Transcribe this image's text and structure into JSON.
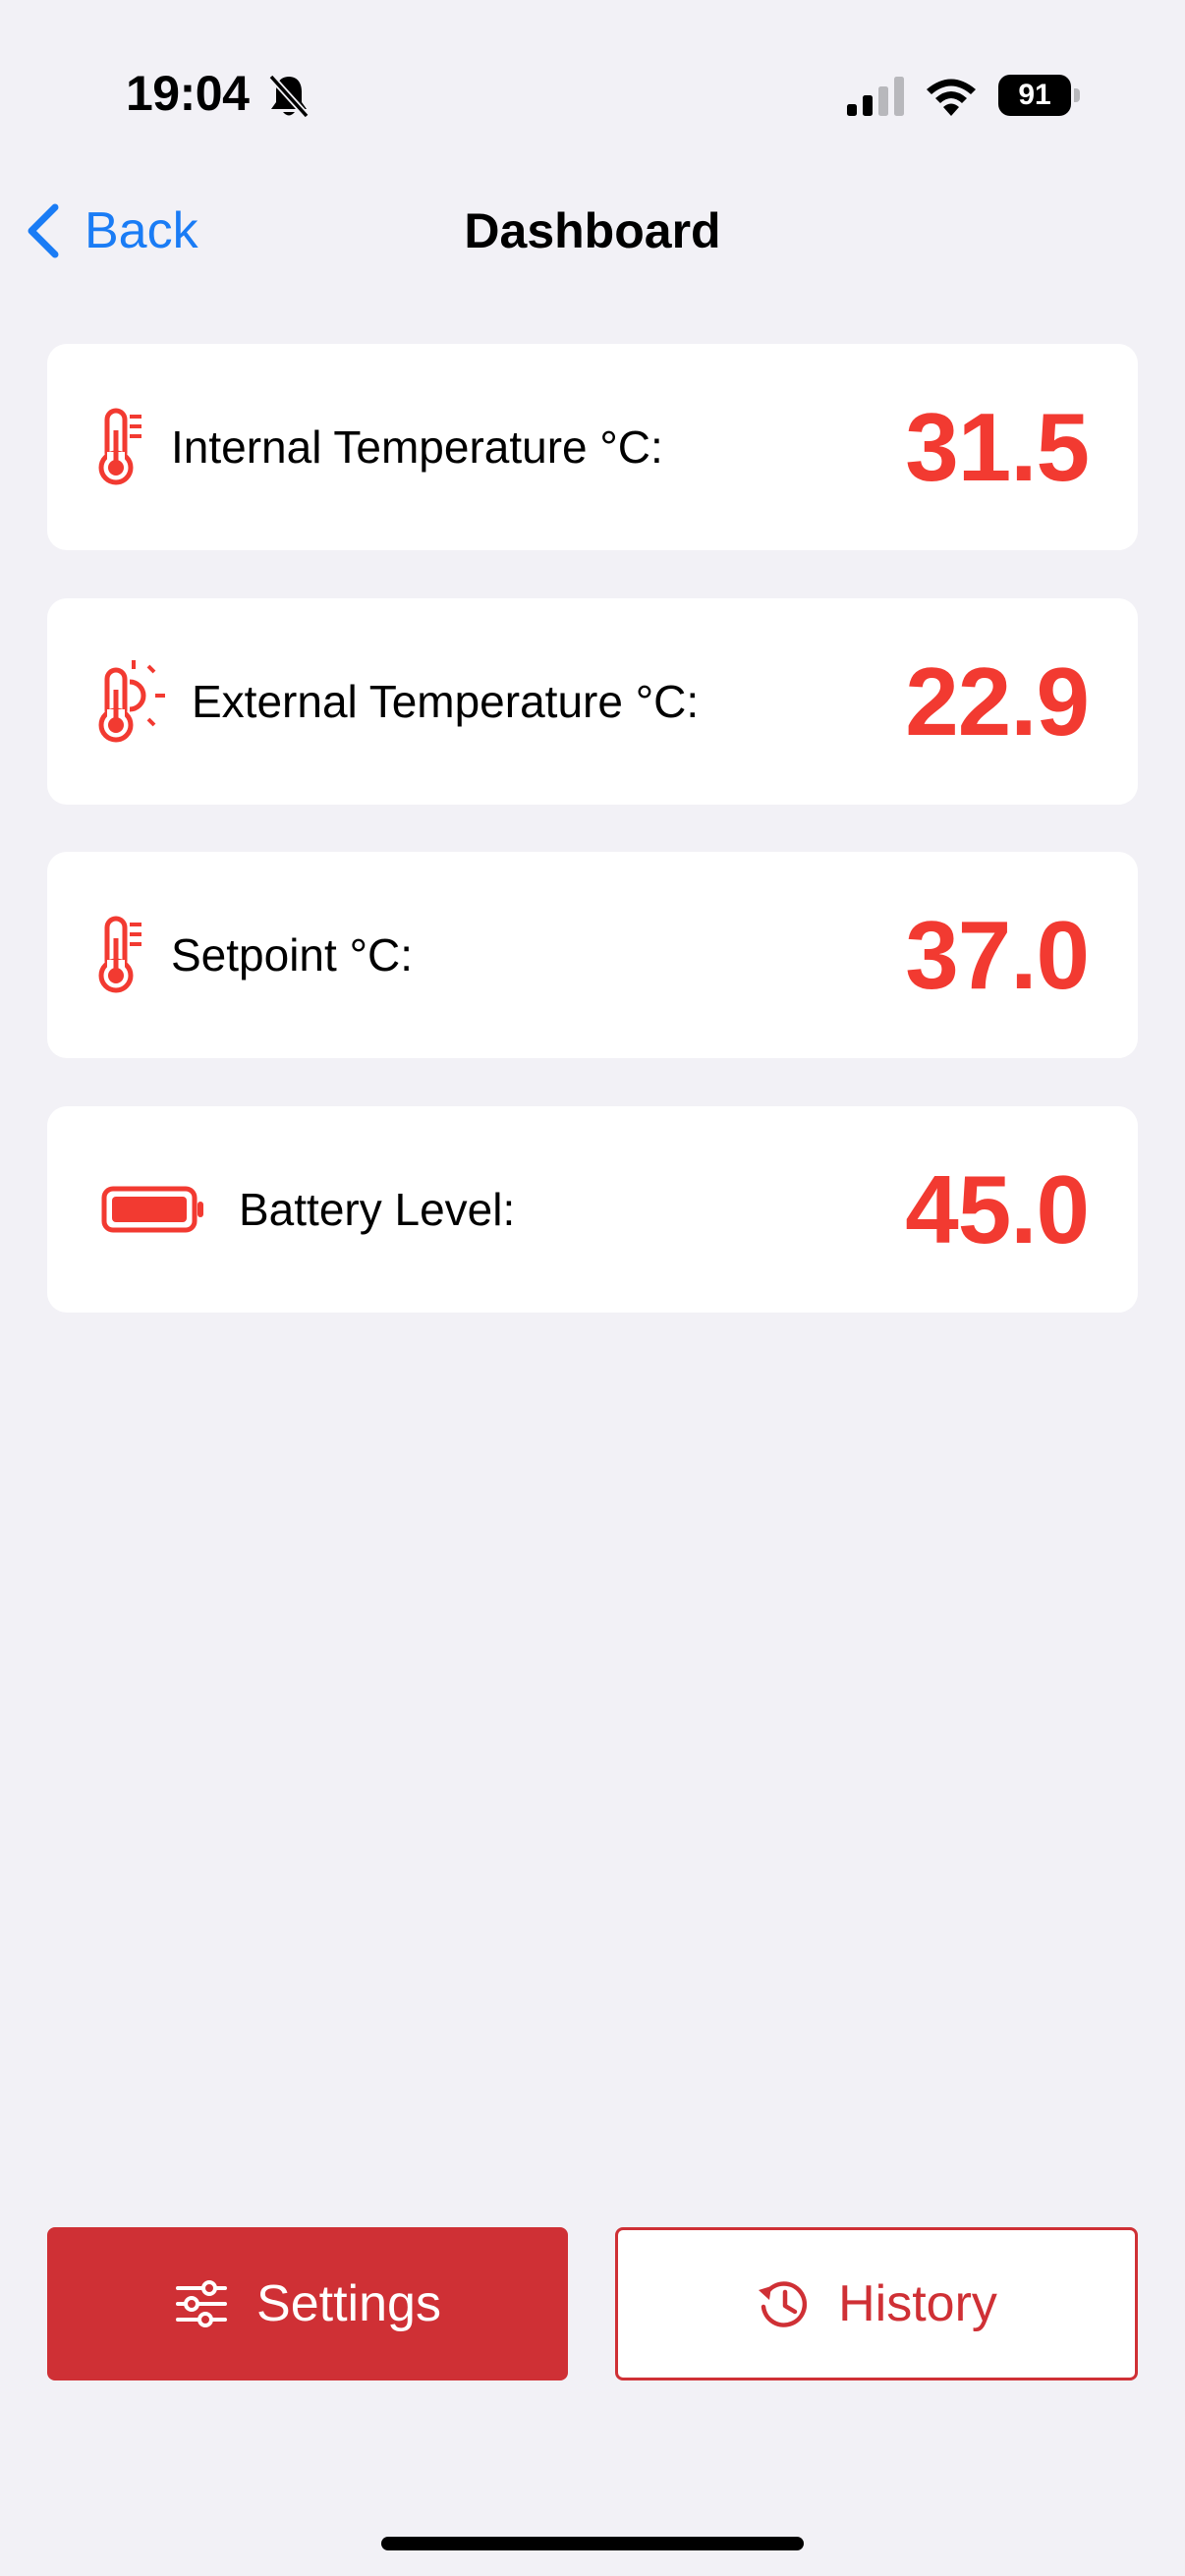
{
  "status_bar": {
    "time": "19:04",
    "battery_percent": "91",
    "icons": [
      "bell-slash-icon",
      "cellular-signal-icon",
      "wifi-icon",
      "battery-icon"
    ]
  },
  "nav": {
    "back_label": "Back",
    "title": "Dashboard"
  },
  "cards": [
    {
      "icon": "thermometer-icon",
      "label": "Internal Temperature °C:",
      "value": "31.5"
    },
    {
      "icon": "thermometer-sun-icon",
      "label": "External Temperature °C:",
      "value": "22.9"
    },
    {
      "icon": "thermometer-icon",
      "label": "Setpoint °C:",
      "value": "37.0"
    },
    {
      "icon": "battery-full-icon",
      "label": "Battery Level:",
      "value": "45.0"
    }
  ],
  "buttons": {
    "settings": {
      "label": "Settings",
      "icon": "sliders-icon"
    },
    "history": {
      "label": "History",
      "icon": "history-clock-icon"
    }
  },
  "colors": {
    "accent_red": "#f23a31",
    "button_red": "#cf3035",
    "link_blue": "#1a7cf5",
    "background": "#f2f1f6"
  }
}
